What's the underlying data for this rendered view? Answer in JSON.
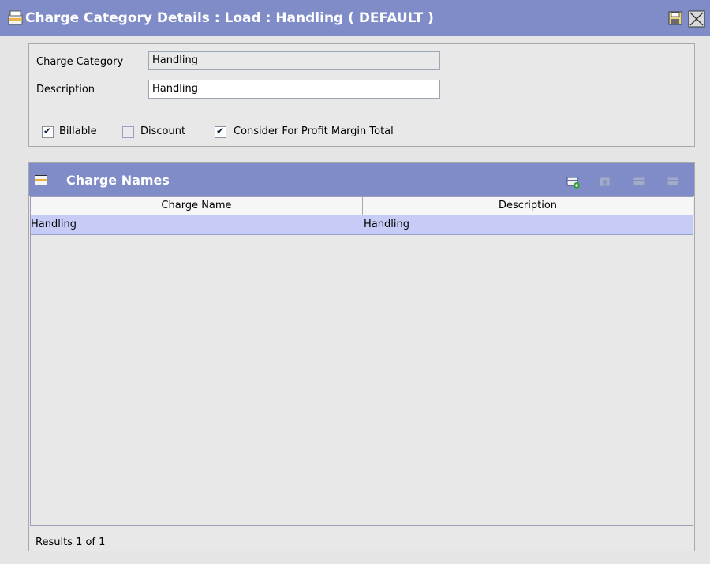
{
  "window": {
    "title": "Charge Category Details : Load : Handling ( DEFAULT )"
  },
  "details": {
    "charge_category_label": "Charge Category",
    "charge_category_value": "Handling",
    "description_label": "Description",
    "description_value": "Handling",
    "checkboxes": [
      {
        "label": "Billable",
        "checked": true
      },
      {
        "label": "Discount",
        "checked": false
      },
      {
        "label": "Consider For Profit Margin Total",
        "checked": true
      }
    ]
  },
  "charge_names": {
    "title": "Charge Names",
    "columns": [
      "Charge Name",
      "Description"
    ],
    "rows": [
      {
        "charge_name": "Handling",
        "description": "Handling"
      }
    ],
    "results": "Results  1 of 1"
  },
  "colors": {
    "header_bg": "#7f8cc8",
    "selected_row": "#c6ccf5",
    "panel_bg": "#e8e8e8"
  }
}
